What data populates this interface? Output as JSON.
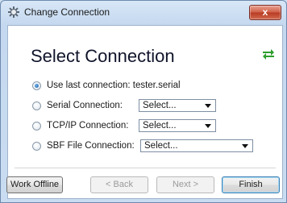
{
  "window": {
    "title": "Change Connection",
    "close_label": "x"
  },
  "dialog": {
    "heading": "Select Connection",
    "options": [
      {
        "label": "Use last connection: tester.serial",
        "checked": true
      },
      {
        "label": "Serial Connection:",
        "combo_value": "Select...",
        "checked": false
      },
      {
        "label": "TCP/IP Connection:",
        "combo_value": "Select...",
        "checked": false
      },
      {
        "label": "SBF File Connection:",
        "combo_value": "Select...",
        "checked": false
      }
    ]
  },
  "buttons": {
    "work_offline": "Work Offline",
    "back": "< Back",
    "next": "Next >",
    "finish": "Finish"
  },
  "icons": {
    "app": "gear-icon",
    "swap": "swap-arrows-icon"
  },
  "colors": {
    "accent_green": "#2e9d2e",
    "close_red": "#c64a32"
  }
}
